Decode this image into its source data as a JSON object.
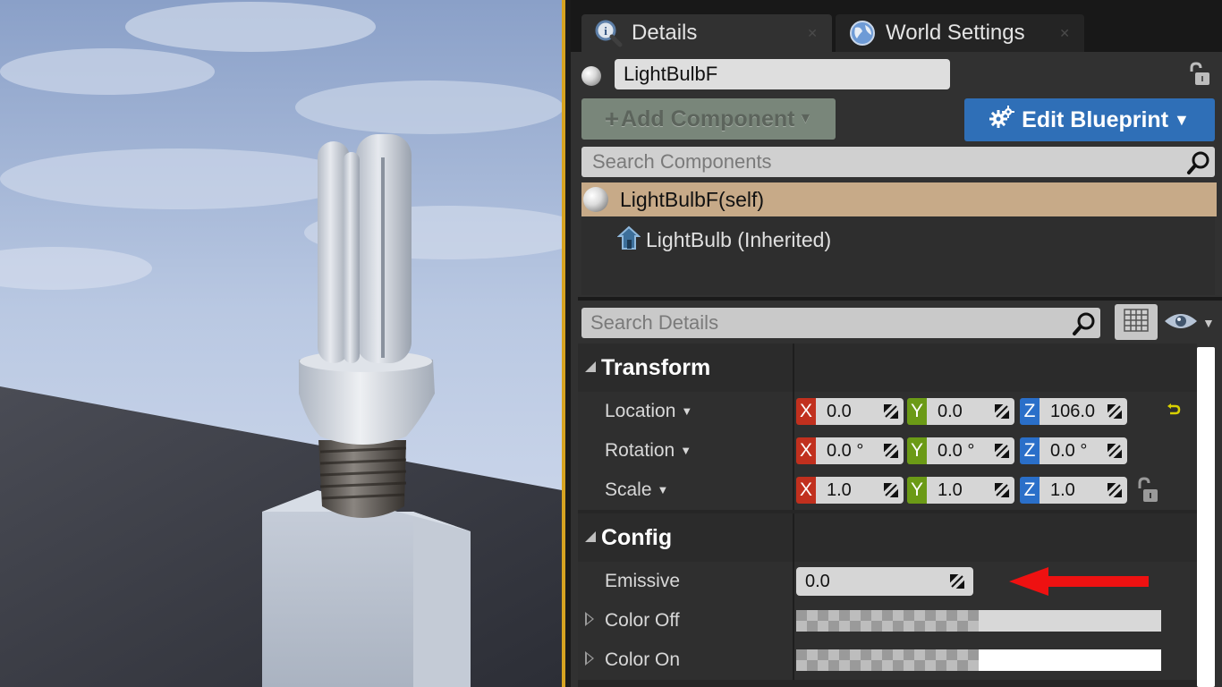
{
  "tabs": [
    {
      "label": "Details",
      "icon": "details-magnifier-icon"
    },
    {
      "label": "World Settings",
      "icon": "globe-icon"
    }
  ],
  "actor": {
    "name": "LightBulbF"
  },
  "toolbar": {
    "add_component_label": "Add Component",
    "edit_blueprint_label": "Edit Blueprint"
  },
  "component_search": {
    "placeholder": "Search Components"
  },
  "components": {
    "self_label": "LightBulbF(self)",
    "child_label": "LightBulb (Inherited)"
  },
  "details_search": {
    "placeholder": "Search Details"
  },
  "transform": {
    "title": "Transform",
    "location": {
      "label": "Location",
      "x": "0.0",
      "y": "0.0",
      "z": "106.0"
    },
    "rotation": {
      "label": "Rotation",
      "x": "0.0 °",
      "y": "0.0 °",
      "z": "0.0 °"
    },
    "scale": {
      "label": "Scale",
      "x": "1.0",
      "y": "1.0",
      "z": "1.0"
    }
  },
  "axis_letters": {
    "x": "X",
    "y": "Y",
    "z": "Z"
  },
  "config": {
    "title": "Config",
    "emissive": {
      "label": "Emissive",
      "value": "0.0"
    },
    "color_off": {
      "label": "Color Off",
      "color": "#d8d8d8"
    },
    "color_on": {
      "label": "Color On",
      "color": "#ffffff"
    }
  },
  "colors": {
    "accent_blue": "#2f6fb7",
    "selected_row": "#c7aa88",
    "viewport_border": "#d6a321",
    "arrow_red": "#ee1111"
  }
}
